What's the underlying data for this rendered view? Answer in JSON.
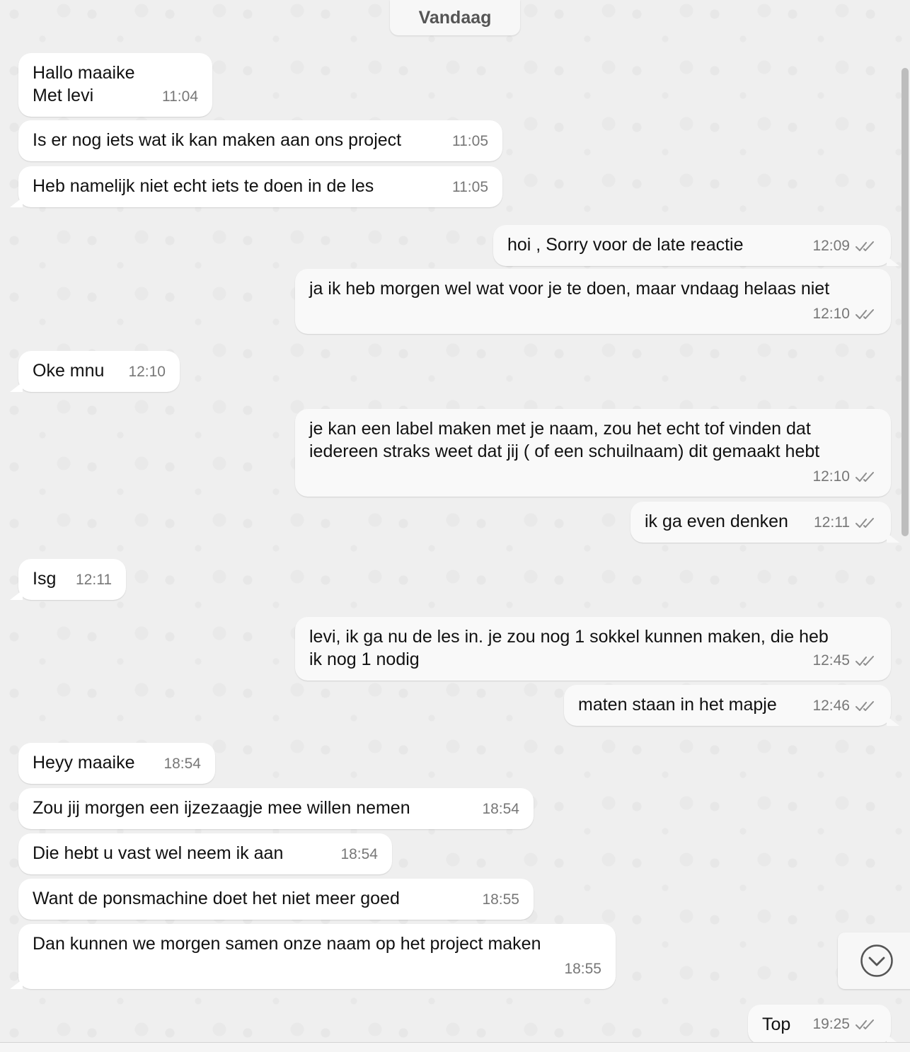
{
  "date_divider": "Vandaag",
  "messages": [
    {
      "dir": "in",
      "text": "Hallo maaike\nMet levi",
      "time": "11:04"
    },
    {
      "dir": "in",
      "text": "Is er nog iets wat ik kan maken aan ons project",
      "time": "11:05"
    },
    {
      "dir": "in",
      "text": "Heb namelijk niet echt iets te doen in de les",
      "time": "11:05"
    },
    {
      "dir": "out",
      "text": "hoi , Sorry voor de late reactie",
      "time": "12:09",
      "status": "read"
    },
    {
      "dir": "out",
      "text": "ja ik heb morgen wel wat voor je te doen, maar vndaag helaas niet",
      "time": "12:10",
      "status": "read"
    },
    {
      "dir": "in",
      "text": "Oke mnu",
      "time": "12:10"
    },
    {
      "dir": "out",
      "text": "je kan een label maken met je naam, zou het echt tof vinden dat\niedereen straks weet dat jij ( of een schuilnaam) dit gemaakt hebt",
      "time": "12:10",
      "status": "read"
    },
    {
      "dir": "out",
      "text": "ik ga even denken",
      "time": "12:11",
      "status": "read"
    },
    {
      "dir": "in",
      "text": "Isg",
      "time": "12:11"
    },
    {
      "dir": "out",
      "text": "levi, ik ga nu de les in. je zou nog 1 sokkel kunnen maken, die heb\nik nog 1 nodig",
      "time": "12:45",
      "status": "read"
    },
    {
      "dir": "out",
      "text": "maten staan in het mapje",
      "time": "12:46",
      "status": "read"
    },
    {
      "dir": "in",
      "text": "Heyy maaike",
      "time": "18:54"
    },
    {
      "dir": "in",
      "text": "Zou jij morgen een ijzezaagje mee willen nemen",
      "time": "18:54"
    },
    {
      "dir": "in",
      "text": "Die hebt u vast wel neem ik aan",
      "time": "18:54"
    },
    {
      "dir": "in",
      "text": "Want de ponsmachine doet het niet meer goed",
      "time": "18:55"
    },
    {
      "dir": "in",
      "text": "Dan kunnen we morgen samen onze naam op het project maken",
      "time": "18:55"
    },
    {
      "dir": "out",
      "text": "Top",
      "time": "19:25",
      "status": "read"
    }
  ],
  "icons": {
    "read_receipt": "double-check-icon",
    "scroll_down": "chevron-down-circle-icon"
  },
  "colors": {
    "incoming_bubble": "#ffffff",
    "outgoing_bubble": "#f9f9f9",
    "read_ticks": "#8e8e8e",
    "time_text": "#777777"
  }
}
